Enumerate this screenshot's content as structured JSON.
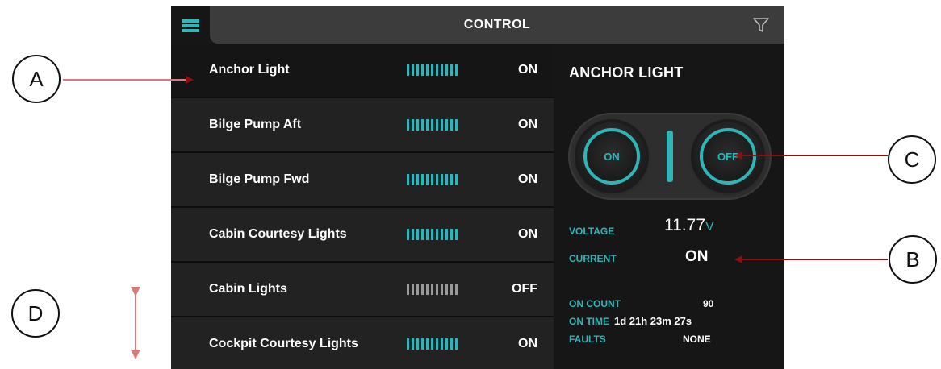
{
  "header": {
    "title": "CONTROL"
  },
  "icons": {
    "menu": "hamburger-menu-icon",
    "filter": "filter-funnel-icon"
  },
  "colors": {
    "accent": "#2fb5b8",
    "background": "#161616",
    "row": "#222222",
    "annotation_arrow": "#d97a7a"
  },
  "list": {
    "items": [
      {
        "label": "Anchor Light",
        "state": "ON",
        "meter": "on",
        "selected": true
      },
      {
        "label": "Bilge Pump Aft",
        "state": "ON",
        "meter": "on"
      },
      {
        "label": "Bilge Pump Fwd",
        "state": "ON",
        "meter": "on"
      },
      {
        "label": "Cabin Courtesy Lights",
        "state": "ON",
        "meter": "on"
      },
      {
        "label": "Cabin Lights",
        "state": "OFF",
        "meter": "off"
      },
      {
        "label": "Cockpit Courtesy Lights",
        "state": "ON",
        "meter": "on"
      }
    ]
  },
  "detail": {
    "title": "ANCHOR LIGHT",
    "toggle": {
      "on_label": "ON",
      "off_label": "OFF"
    },
    "voltage": {
      "label": "VOLTAGE",
      "value": "11.77",
      "unit": "V"
    },
    "current": {
      "label": "CURRENT",
      "value": "ON"
    },
    "stats": {
      "on_count": {
        "label": "ON COUNT",
        "value": "90"
      },
      "on_time": {
        "label": "ON TIME",
        "value": "1d 21h 23m 27s"
      },
      "faults": {
        "label": "FAULTS",
        "value": "NONE"
      }
    }
  },
  "annotations": {
    "a": "A",
    "b": "B",
    "c": "C",
    "d": "D"
  }
}
